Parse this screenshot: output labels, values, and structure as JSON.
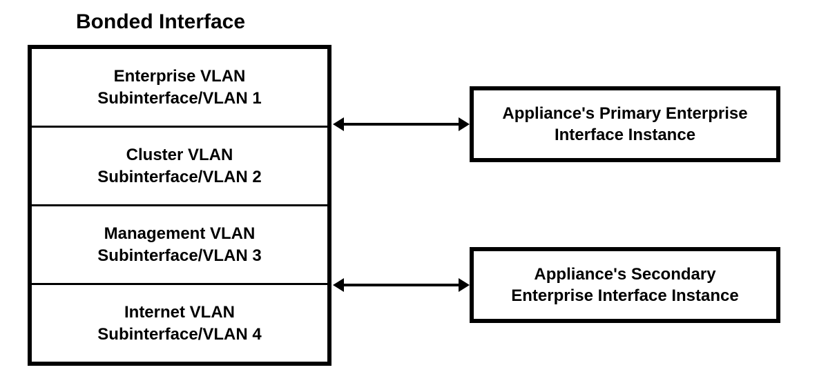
{
  "title": "Bonded Interface",
  "bonded": {
    "rows": [
      {
        "line1": "Enterprise VLAN",
        "line2": "Subinterface/VLAN 1"
      },
      {
        "line1": "Cluster VLAN",
        "line2": "Subinterface/VLAN 2"
      },
      {
        "line1": "Management VLAN",
        "line2": "Subinterface/VLAN 3"
      },
      {
        "line1": "Internet VLAN",
        "line2": "Subinterface/VLAN 4"
      }
    ]
  },
  "right": {
    "primary": {
      "line1": "Appliance's Primary Enterprise",
      "line2": "Interface Instance"
    },
    "secondary": {
      "line1": "Appliance's Secondary",
      "line2": "Enterprise Interface Instance"
    }
  }
}
